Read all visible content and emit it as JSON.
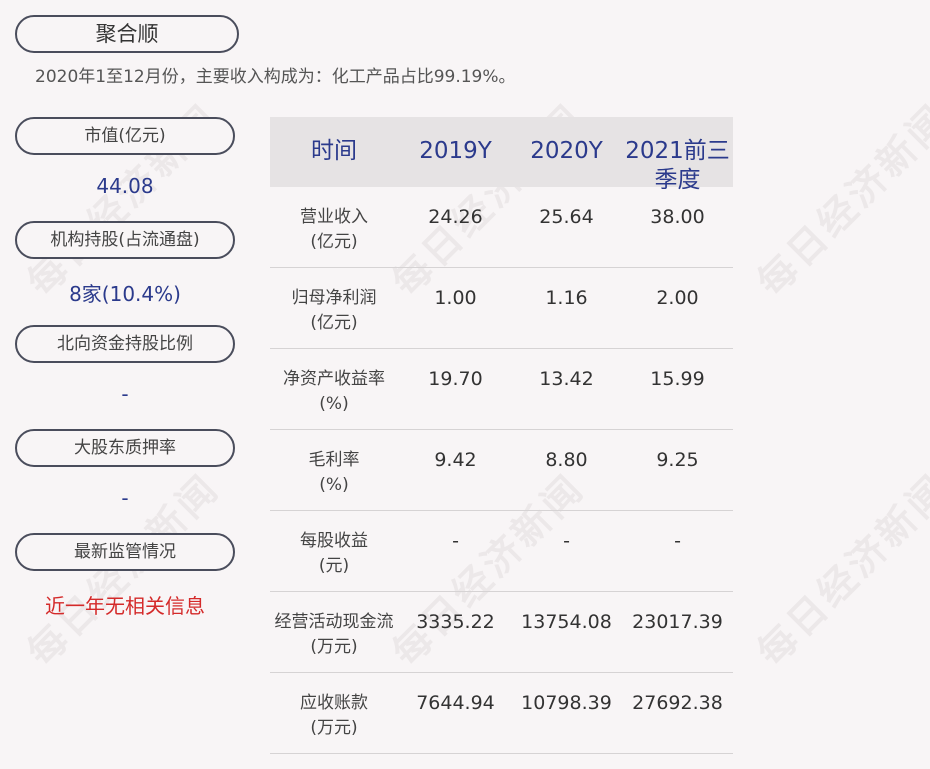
{
  "company": "聚合顺",
  "summary": "2020年1至12月份，主要收入构成为：化工产品占比99.19%。",
  "watermark": "每日经济新闻",
  "metrics": [
    {
      "label": "市值(亿元)",
      "value": "44.08"
    },
    {
      "label": "机构持股(占流通盘)",
      "value": "8家(10.4%)"
    },
    {
      "label": "北向资金持股比例",
      "value": "-"
    },
    {
      "label": "大股东质押率",
      "value": "-"
    },
    {
      "label": "最新监管情况",
      "value": "近一年无相关信息"
    }
  ],
  "table": {
    "headers": [
      "时间",
      "2019Y",
      "2020Y",
      "2021前三季度"
    ],
    "rows": [
      {
        "label": "营业收入",
        "unit": "(亿元)",
        "values": [
          "24.26",
          "25.64",
          "38.00"
        ]
      },
      {
        "label": "归母净利润",
        "unit": "(亿元)",
        "values": [
          "1.00",
          "1.16",
          "2.00"
        ]
      },
      {
        "label": "净资产收益率",
        "unit": "(%)",
        "values": [
          "19.70",
          "13.42",
          "15.99"
        ]
      },
      {
        "label": "毛利率",
        "unit": "(%)",
        "values": [
          "9.42",
          "8.80",
          "9.25"
        ]
      },
      {
        "label": "每股收益",
        "unit": "(元)",
        "values": [
          "-",
          "-",
          "-"
        ]
      },
      {
        "label": "经营活动现金流",
        "unit": "(万元)",
        "values": [
          "3335.22",
          "13754.08",
          "23017.39"
        ]
      },
      {
        "label": "应收账款",
        "unit": "(万元)",
        "values": [
          "7644.94",
          "10798.39",
          "27692.38"
        ]
      }
    ]
  }
}
